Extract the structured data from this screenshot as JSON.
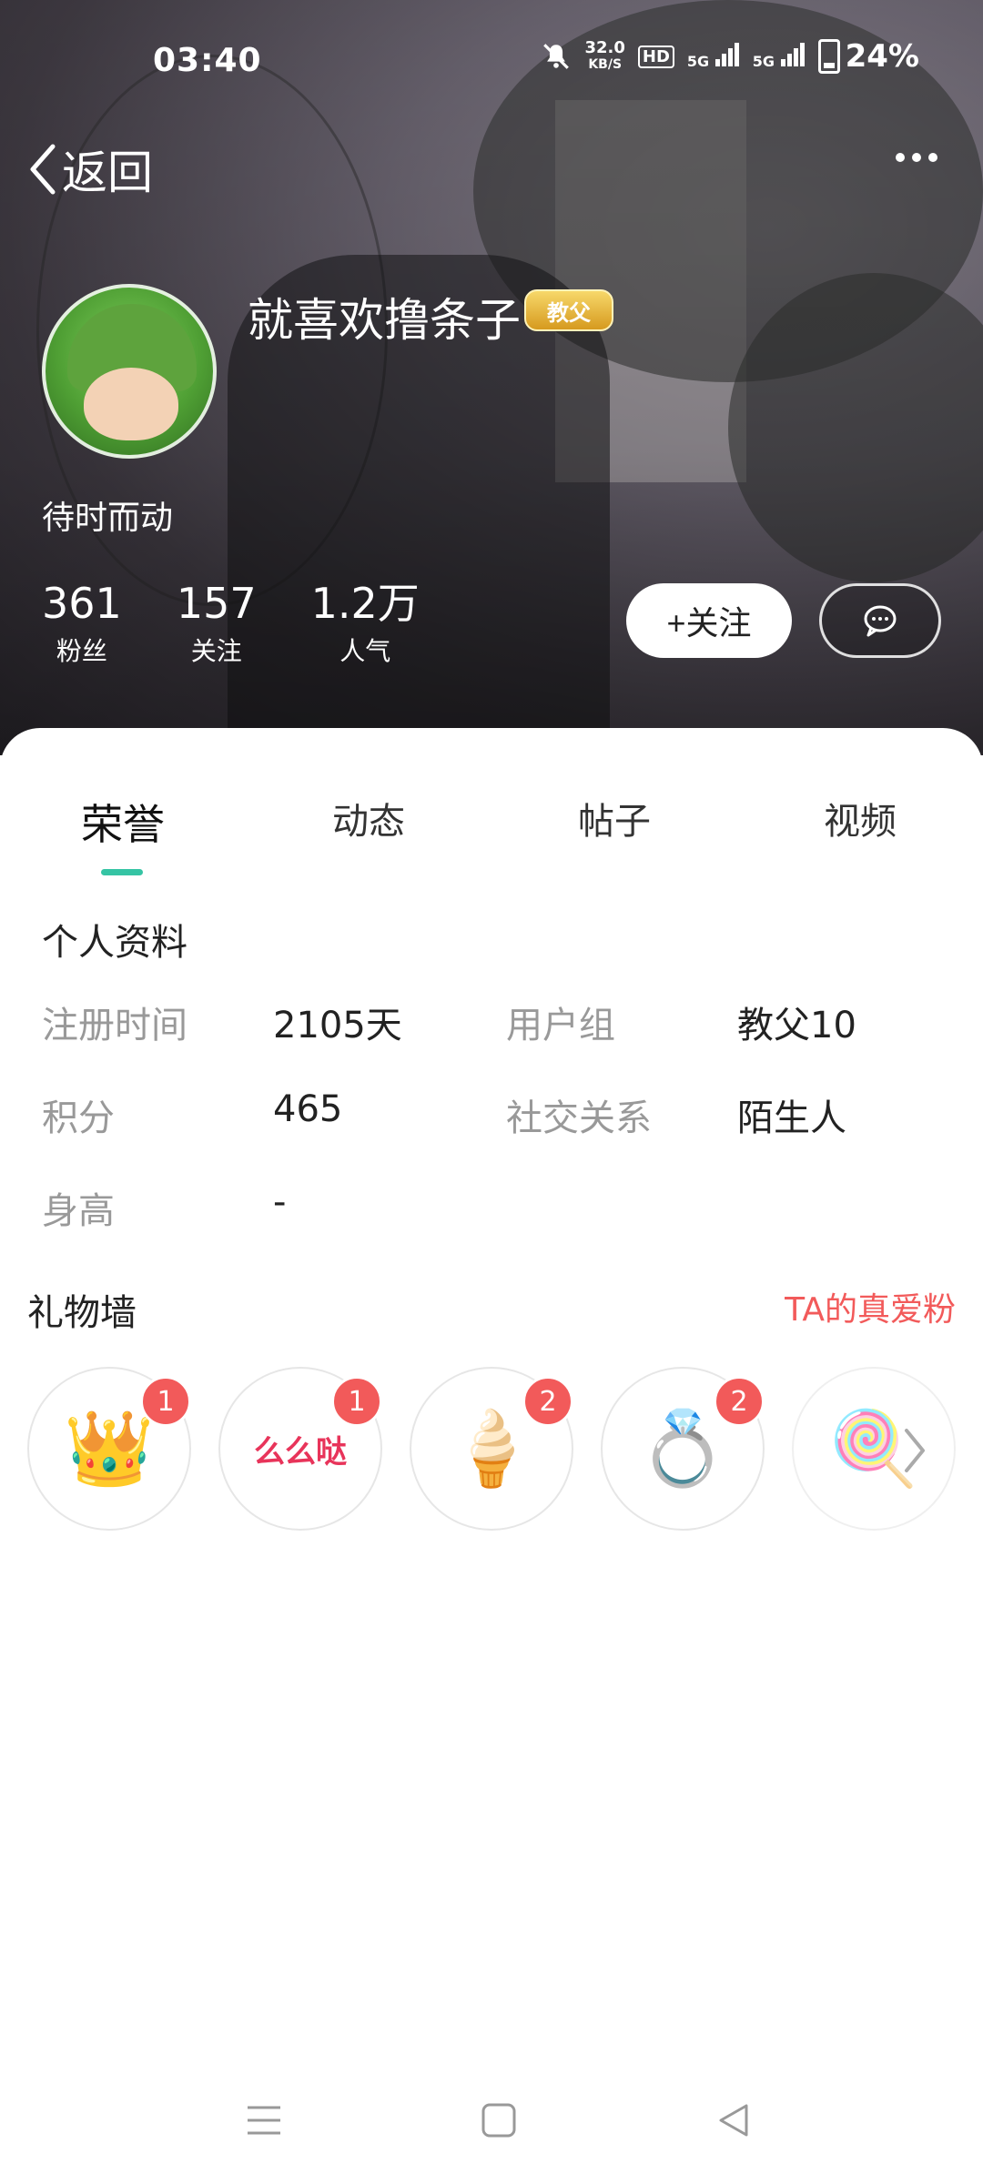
{
  "status_bar": {
    "time": "03:40",
    "net_speed_value": "32.0",
    "net_speed_unit": "KB/S",
    "hd_label": "HD",
    "signal1": "5G",
    "signal2": "5G",
    "battery": "24%"
  },
  "header": {
    "back_label": "返回",
    "username": "就喜欢撸条子",
    "rank_badge": "教父",
    "bio": "待时而动"
  },
  "stats": [
    {
      "value": "361",
      "label": "粉丝"
    },
    {
      "value": "157",
      "label": "关注"
    },
    {
      "value": "1.2万",
      "label": "人气"
    }
  ],
  "actions": {
    "follow_label": "+关注"
  },
  "tabs": [
    {
      "label": "荣誉",
      "active": true
    },
    {
      "label": "动态",
      "active": false
    },
    {
      "label": "帖子",
      "active": false
    },
    {
      "label": "视频",
      "active": false
    }
  ],
  "profile": {
    "title": "个人资料",
    "rows": [
      {
        "label": "注册时间",
        "value": "2105天"
      },
      {
        "label": "用户组",
        "value": "教父10"
      },
      {
        "label": "积分",
        "value": "465"
      },
      {
        "label": "社交关系",
        "value": "陌生人"
      },
      {
        "label": "身高",
        "value": "-"
      }
    ]
  },
  "gifts": {
    "title": "礼物墙",
    "link": "TA的真爱粉",
    "items": [
      {
        "icon": "crown-icon",
        "glyph": "👑",
        "count": "1"
      },
      {
        "icon": "kiss-text-icon",
        "glyph": "么么哒",
        "count": "1"
      },
      {
        "icon": "ice-cream-icon",
        "glyph": "🍦",
        "count": "2"
      },
      {
        "icon": "ring-icon",
        "glyph": "💍",
        "count": "2"
      },
      {
        "icon": "lollipop-icon",
        "glyph": "🍭",
        "count": ""
      }
    ]
  },
  "colors": {
    "accent": "#35c4a4",
    "badge_red": "#f25a5a"
  }
}
